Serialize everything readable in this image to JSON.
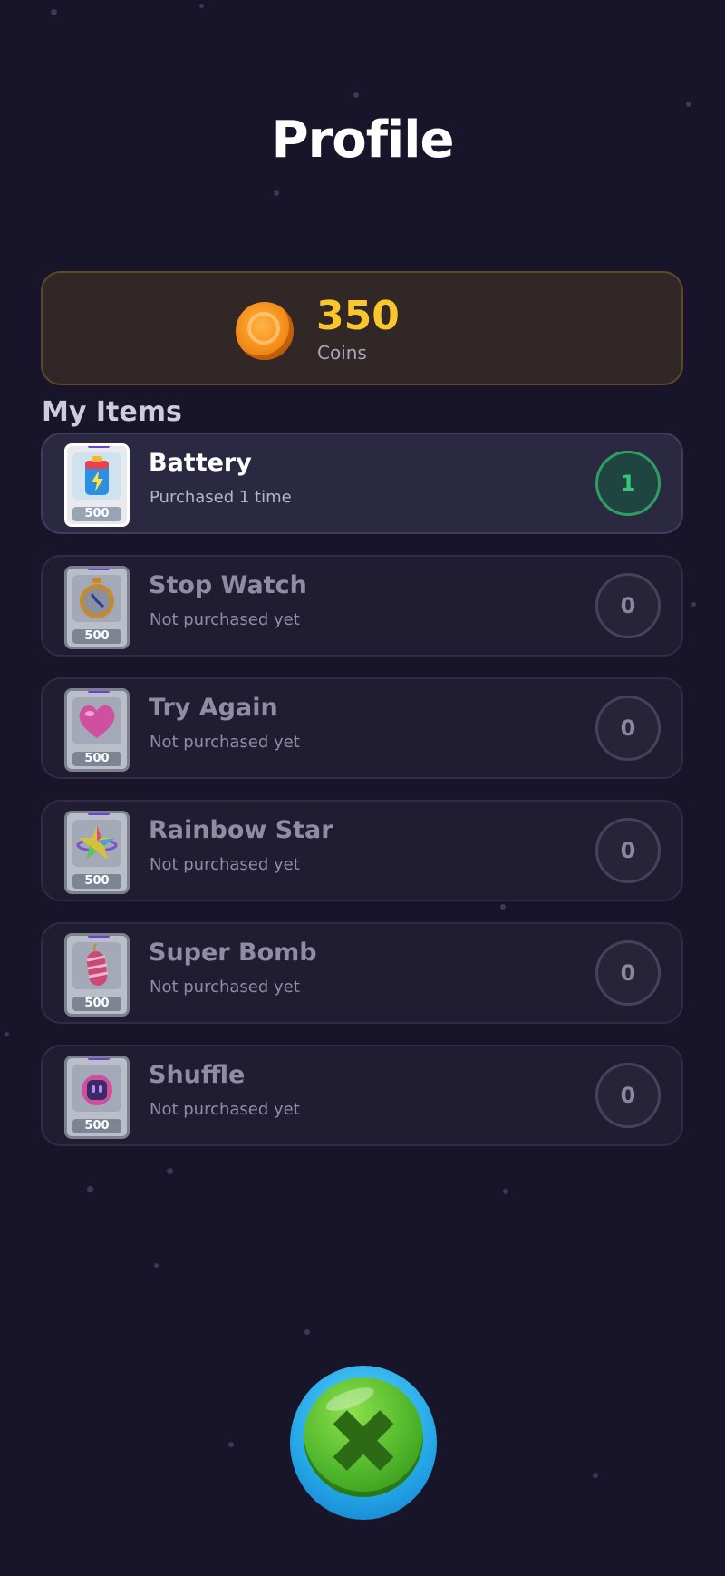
{
  "header": {
    "title": "Profile"
  },
  "wallet": {
    "amount": "350",
    "label": "Coins",
    "icon": "coin-icon"
  },
  "items_section": {
    "title": "My Items"
  },
  "items": [
    {
      "name": "Battery",
      "status": "Purchased 1 time",
      "count": "1",
      "price": "500",
      "icon": "battery-icon",
      "owned": true
    },
    {
      "name": "Stop Watch",
      "status": "Not purchased yet",
      "count": "0",
      "price": "500",
      "icon": "stopwatch-icon",
      "owned": false
    },
    {
      "name": "Try Again",
      "status": "Not purchased yet",
      "count": "0",
      "price": "500",
      "icon": "heart-icon",
      "owned": false
    },
    {
      "name": "Rainbow Star",
      "status": "Not purchased yet",
      "count": "0",
      "price": "500",
      "icon": "rainbow-star-icon",
      "owned": false
    },
    {
      "name": "Super Bomb",
      "status": "Not purchased yet",
      "count": "0",
      "price": "500",
      "icon": "bomb-icon",
      "owned": false
    },
    {
      "name": "Shuffle",
      "status": "Not purchased yet",
      "count": "0",
      "price": "500",
      "icon": "shuffle-icon",
      "owned": false
    }
  ],
  "close_button": {
    "icon": "close-icon",
    "glyph": "✖"
  },
  "colors": {
    "background": "#18152b",
    "coin_text": "#f9c62b",
    "owned_count": "#35c67a",
    "close_button_green": "#4fb62b",
    "close_button_blue": "#23a6e6"
  }
}
